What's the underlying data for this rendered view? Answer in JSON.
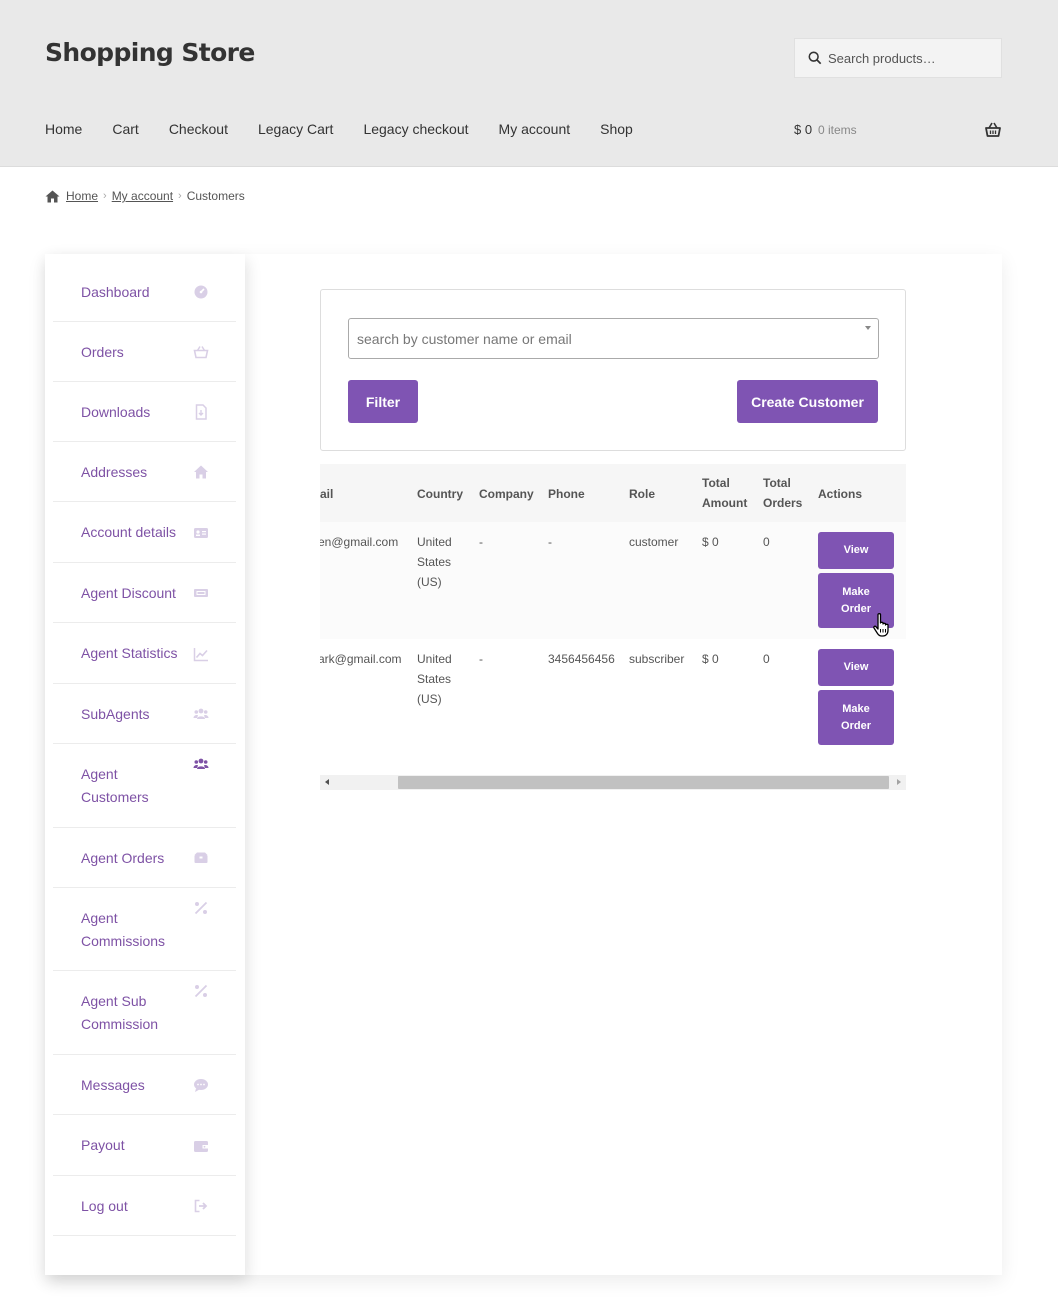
{
  "header": {
    "site_title": "Shopping Store",
    "search_placeholder": "Search products…",
    "nav": [
      "Home",
      "Cart",
      "Checkout",
      "Legacy Cart",
      "Legacy checkout",
      "My account",
      "Shop"
    ],
    "cart_amount": "$ 0",
    "cart_count": "0 items"
  },
  "breadcrumb": {
    "home": "Home",
    "my_account": "My account",
    "current": "Customers"
  },
  "sidebar": {
    "items": [
      {
        "label": "Dashboard",
        "icon": "dashboard-icon"
      },
      {
        "label": "Orders",
        "icon": "basket-icon"
      },
      {
        "label": "Downloads",
        "icon": "file-download-icon"
      },
      {
        "label": "Addresses",
        "icon": "home-icon"
      },
      {
        "label": "Account details",
        "icon": "id-card-icon"
      },
      {
        "label": "Agent Discount",
        "icon": "ticket-icon"
      },
      {
        "label": "Agent Statistics",
        "icon": "line-chart-icon"
      },
      {
        "label": "SubAgents",
        "icon": "users-icon"
      },
      {
        "label": "Agent\nCustomers",
        "icon": "users-icon"
      },
      {
        "label": "Agent Orders",
        "icon": "boxes-icon"
      },
      {
        "label": "Agent\nCommissions",
        "icon": "percent-icon"
      },
      {
        "label": "Agent Sub\nCommission",
        "icon": "percent-icon"
      },
      {
        "label": "Messages",
        "icon": "chat-icon"
      },
      {
        "label": "Payout",
        "icon": "wallet-icon"
      },
      {
        "label": "Log out",
        "icon": "sign-out-icon"
      }
    ],
    "active_color": "#7e52a5",
    "icon_color": "#d9cfe6",
    "active_icon_color": "#7e52a5"
  },
  "filter": {
    "search_placeholder": "search by customer name or email",
    "filter_label": "Filter",
    "create_label": "Create Customer"
  },
  "table": {
    "headers": {
      "email": "ail",
      "country": "Country",
      "company": "Company",
      "phone": "Phone",
      "role": "Role",
      "total_amount_1": "Total",
      "total_amount_2": "Amount",
      "total_orders_1": "Total",
      "total_orders_2": "Orders",
      "actions": "Actions"
    },
    "rows": [
      {
        "email": "en@gmail.com",
        "country_1": "United",
        "country_2": "States",
        "country_3": "(US)",
        "company": "-",
        "phone": "-",
        "role": "customer",
        "total_amount": "$ 0",
        "total_orders": "0",
        "view_label": "View",
        "order_label_1": "Make",
        "order_label_2": "Order"
      },
      {
        "email": "ark@gmail.com",
        "country_1": "United",
        "country_2": "States",
        "country_3": "(US)",
        "company": "-",
        "phone": "3456456456",
        "role": "subscriber",
        "total_amount": "$ 0",
        "total_orders": "0",
        "view_label": "View",
        "order_label_1": "Make",
        "order_label_2": "Order"
      }
    ]
  },
  "colors": {
    "accent": "#7f54b3",
    "header_bg": "#e9e9e9"
  }
}
